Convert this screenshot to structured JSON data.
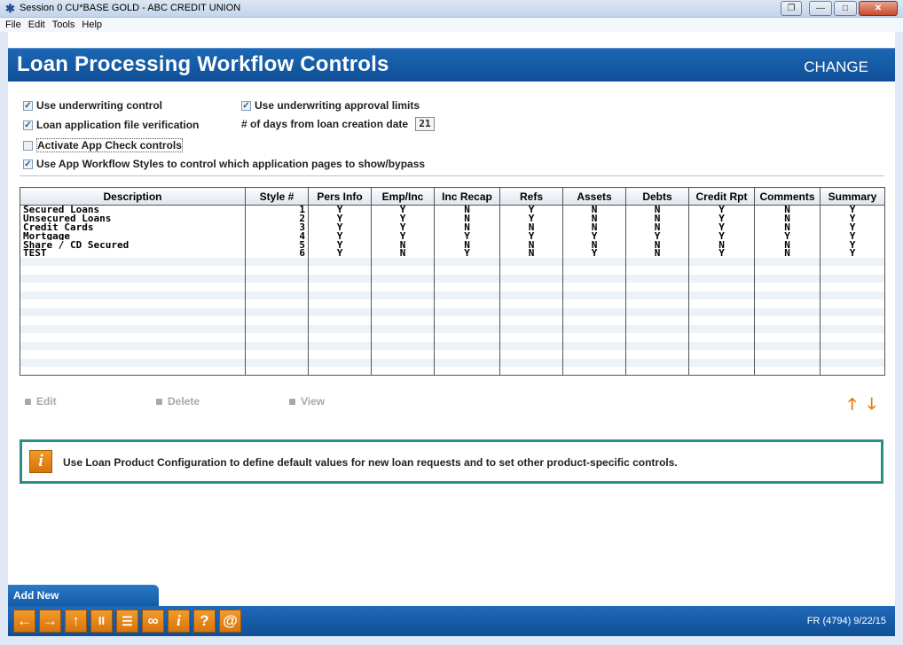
{
  "window": {
    "title": "Session 0 CU*BASE GOLD - ABC CREDIT UNION",
    "menu": [
      "File",
      "Edit",
      "Tools",
      "Help"
    ]
  },
  "header": {
    "title": "Loan Processing Workflow Controls",
    "mode": "CHANGE"
  },
  "options": {
    "use_underwriting_control": {
      "label": "Use underwriting control",
      "checked": true
    },
    "use_underwriting_approval_limits": {
      "label": "Use underwriting approval limits",
      "checked": true
    },
    "loan_application_file_verification": {
      "label": "Loan application file verification",
      "checked": true
    },
    "days_from_creation_label": "# of days from loan creation date",
    "days_from_creation_value": "21",
    "activate_app_check": {
      "label": "Activate App Check controls",
      "checked": false
    },
    "use_app_workflow_styles": {
      "label": "Use App Workflow Styles to control which application pages to show/bypass",
      "checked": true
    }
  },
  "table": {
    "columns": [
      "Description",
      "Style #",
      "Pers Info",
      "Emp/Inc",
      "Inc Recap",
      "Refs",
      "Assets",
      "Debts",
      "Credit Rpt",
      "Comments",
      "Summary"
    ],
    "rows": [
      {
        "description": "Secured Loans",
        "style": "1",
        "flags": [
          "Y",
          "Y",
          "N",
          "Y",
          "N",
          "N",
          "Y",
          "N",
          "Y"
        ]
      },
      {
        "description": "Unsecured Loans",
        "style": "2",
        "flags": [
          "Y",
          "Y",
          "N",
          "Y",
          "N",
          "N",
          "Y",
          "N",
          "Y"
        ]
      },
      {
        "description": "Credit Cards",
        "style": "3",
        "flags": [
          "Y",
          "Y",
          "N",
          "N",
          "N",
          "N",
          "Y",
          "N",
          "Y"
        ]
      },
      {
        "description": "Mortgage",
        "style": "4",
        "flags": [
          "Y",
          "Y",
          "Y",
          "Y",
          "Y",
          "Y",
          "Y",
          "Y",
          "Y"
        ]
      },
      {
        "description": "Share / CD Secured",
        "style": "5",
        "flags": [
          "Y",
          "N",
          "N",
          "N",
          "N",
          "N",
          "N",
          "N",
          "Y"
        ]
      },
      {
        "description": "TEST",
        "style": "6",
        "flags": [
          "Y",
          "N",
          "Y",
          "N",
          "Y",
          "N",
          "Y",
          "N",
          "Y"
        ]
      }
    ]
  },
  "actions": {
    "edit": "Edit",
    "delete": "Delete",
    "view": "View"
  },
  "info": {
    "text": "Use Loan Product Configuration to define default values for new loan requests and to set other product-specific controls."
  },
  "footer": {
    "add_new": "Add New",
    "toolbar_glyphs": [
      "←",
      "→",
      "↑",
      "II",
      "☰",
      "∞",
      "i",
      "?",
      "@"
    ],
    "screen_id": "FR (4794) 9/22/15"
  },
  "colors": {
    "header_blue": "#1565b0",
    "accent_orange": "#e57d0c",
    "info_border": "#2c8e87"
  }
}
